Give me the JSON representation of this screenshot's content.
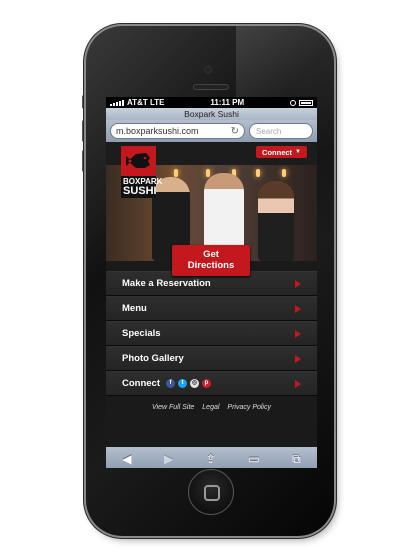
{
  "status": {
    "carrier": "AT&T",
    "network": "LTE",
    "time": "11:11 PM"
  },
  "browser": {
    "title": "Boxpark Sushi",
    "url": "m.boxparksushi.com",
    "search_placeholder": "Search"
  },
  "site": {
    "connect_label": "Connect",
    "logo_text_line1": "BOXPARK",
    "logo_text_line2": "SUSHI",
    "directions_line1": "Get",
    "directions_line2": "Directions",
    "menu": [
      {
        "label": "Make a Reservation"
      },
      {
        "label": "Menu"
      },
      {
        "label": "Specials"
      },
      {
        "label": "Photo Gallery"
      },
      {
        "label": "Connect"
      }
    ],
    "footer_links": [
      "View Full Site",
      "Legal",
      "Privacy Policy"
    ]
  },
  "colors": {
    "brand_red": "#c3181e",
    "background": "#1a1a1a"
  },
  "icons": [
    "reload-icon",
    "fish-logo-icon",
    "facebook-icon",
    "twitter-icon",
    "instagram-icon",
    "pinterest-icon",
    "back-icon",
    "forward-icon",
    "share-icon",
    "bookmarks-icon",
    "tabs-icon"
  ]
}
